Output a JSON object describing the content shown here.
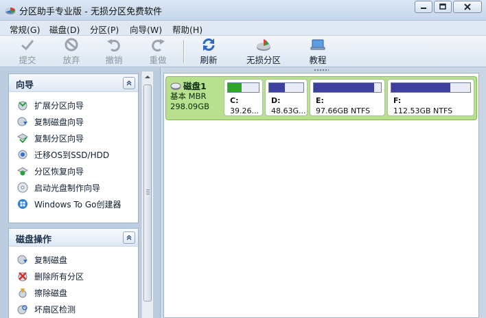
{
  "window": {
    "title": "分区助手专业版 - 无损分区免费软件",
    "icon": "app-disk-icon",
    "buttons": [
      "minimize-icon",
      "maximize-icon",
      "close-icon"
    ]
  },
  "menu": [
    {
      "label": "常规(G)"
    },
    {
      "label": "磁盘(D)"
    },
    {
      "label": "分区(P)"
    },
    {
      "label": "向导(W)"
    },
    {
      "label": "帮助(H)"
    }
  ],
  "toolbar": [
    {
      "label": "提交",
      "icon": "commit-icon",
      "enabled": false
    },
    {
      "label": "放弃",
      "icon": "discard-icon",
      "enabled": false
    },
    {
      "label": "撤销",
      "icon": "undo-icon",
      "enabled": false
    },
    {
      "label": "重做",
      "icon": "redo-icon",
      "enabled": false
    },
    {
      "label": "刷新",
      "icon": "refresh-icon",
      "enabled": true
    },
    {
      "label": "无损分区",
      "icon": "lossless-partition-icon",
      "enabled": true
    },
    {
      "label": "教程",
      "icon": "tutorial-icon",
      "enabled": true
    }
  ],
  "sidebar": {
    "wizard_panel": {
      "title": "向导",
      "items": [
        {
          "label": "扩展分区向导",
          "icon": "extend-partition-icon"
        },
        {
          "label": "复制磁盘向导",
          "icon": "copy-disk-icon"
        },
        {
          "label": "复制分区向导",
          "icon": "copy-partition-icon"
        },
        {
          "label": "迁移OS到SSD/HDD",
          "icon": "migrate-os-icon"
        },
        {
          "label": "分区恢复向导",
          "icon": "partition-recovery-icon"
        },
        {
          "label": "启动光盘制作向导",
          "icon": "bootable-media-icon"
        },
        {
          "label": "Windows To Go创建器",
          "icon": "windows-to-go-icon"
        }
      ]
    },
    "disk_panel": {
      "title": "磁盘操作",
      "items": [
        {
          "label": "复制磁盘",
          "icon": "copy-disk-icon"
        },
        {
          "label": "删除所有分区",
          "icon": "delete-all-icon"
        },
        {
          "label": "擦除磁盘",
          "icon": "wipe-disk-icon"
        },
        {
          "label": "坏扇区检测",
          "icon": "bad-sector-icon"
        }
      ]
    }
  },
  "disk": {
    "name": "磁盘1",
    "type": "基本 MBR",
    "size": "298.09GB",
    "partitions": [
      {
        "label": "C:",
        "size": "39.26...",
        "used_fraction": 0.45,
        "fill_color": "#2fa52b"
      },
      {
        "label": "D:",
        "size": "48.63G...",
        "used_fraction": 0.45,
        "fill_color": "#3f3f9e"
      },
      {
        "label": "E:",
        "size": "97.66GB NTFS",
        "used_fraction": 0.9,
        "fill_color": "#3f3f9e"
      },
      {
        "label": "F:",
        "size": "112.53GB NTFS",
        "used_fraction": 0.75,
        "fill_color": "#3f3f9e"
      }
    ]
  },
  "colors": {
    "disk_row": "#b8e08e",
    "sidebar_bg": "#bccde2",
    "used_bar": "#3f3f9e",
    "system_bar": "#2fa52b"
  }
}
